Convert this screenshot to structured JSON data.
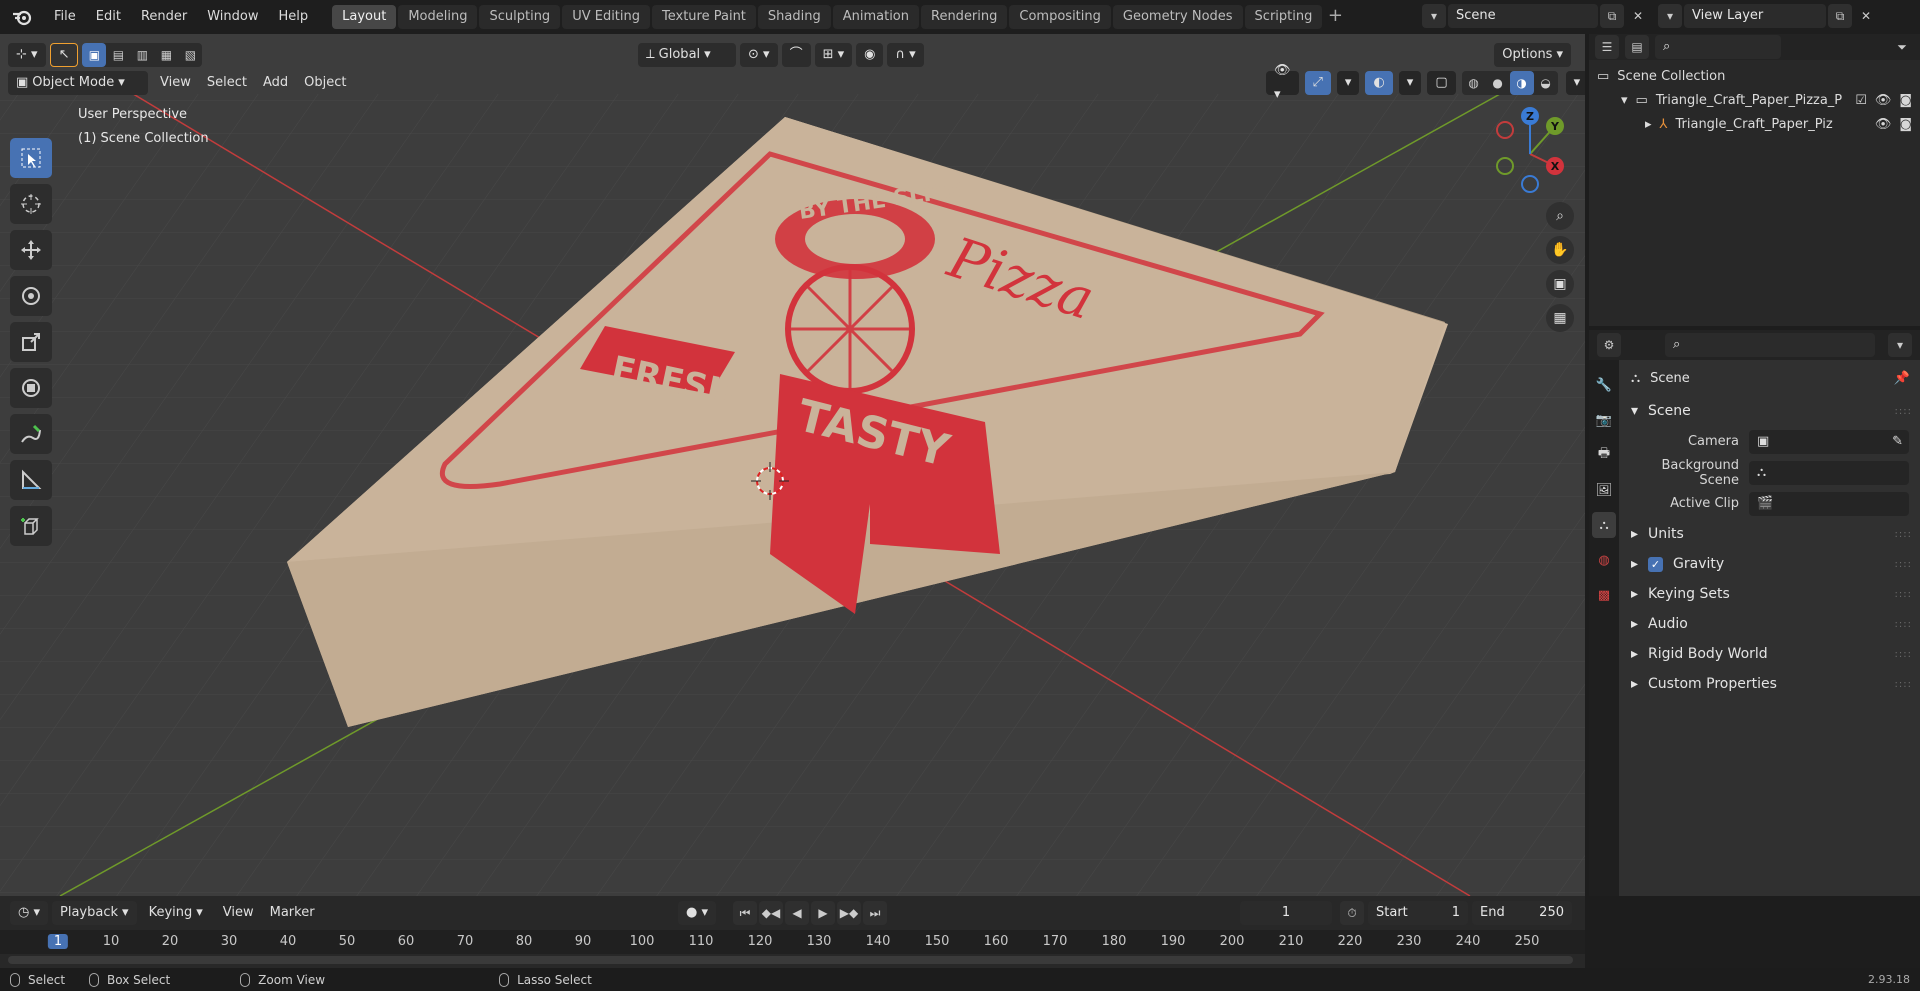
{
  "topbar": {
    "menus": [
      "File",
      "Edit",
      "Render",
      "Window",
      "Help"
    ],
    "workspaces": [
      "Layout",
      "Modeling",
      "Sculpting",
      "UV Editing",
      "Texture Paint",
      "Shading",
      "Animation",
      "Rendering",
      "Compositing",
      "Geometry Nodes",
      "Scripting"
    ],
    "active_workspace": "Layout",
    "scene_name": "Scene",
    "view_layer": "View Layer"
  },
  "viewport": {
    "mode": "Object Mode",
    "menus": [
      "View",
      "Select",
      "Add",
      "Object"
    ],
    "transform_orientation": "Global",
    "options_label": "Options",
    "overlay_line1": "User Perspective",
    "overlay_line2": "(1) Scene Collection",
    "object_text": {
      "by_the_slice": "BY THE SLICE",
      "pizza": "Pizza",
      "fresh": "FRESH",
      "tasty": "TASTY"
    },
    "colors": {
      "box": "#c9b39a",
      "print": "#d2333c",
      "x_axis": "#c23c3c",
      "y_axis": "#6f9a2a",
      "bg": "#3d3d3d"
    }
  },
  "gizmo": {
    "x": "X",
    "y": "Y",
    "z": "Z"
  },
  "outliner": {
    "root": "Scene Collection",
    "items": [
      {
        "label": "Triangle_Craft_Paper_Pizza_P",
        "type": "collection"
      },
      {
        "label": "Triangle_Craft_Paper_Piz",
        "type": "object"
      }
    ]
  },
  "properties": {
    "title": "Scene",
    "panel": "Scene",
    "fields": [
      {
        "label": "Camera",
        "value": ""
      },
      {
        "label": "Background Scene",
        "value": ""
      },
      {
        "label": "Active Clip",
        "value": ""
      }
    ],
    "sections": [
      "Units",
      "Gravity",
      "Keying Sets",
      "Audio",
      "Rigid Body World",
      "Custom Properties"
    ],
    "gravity_checked": true
  },
  "timeline": {
    "menus": [
      "Playback",
      "Keying",
      "View",
      "Marker"
    ],
    "current_frame": "1",
    "start_label": "Start",
    "start": "1",
    "end_label": "End",
    "end": "250",
    "ticks": [
      "1",
      "10",
      "20",
      "30",
      "40",
      "50",
      "60",
      "70",
      "80",
      "90",
      "100",
      "110",
      "120",
      "130",
      "140",
      "150",
      "160",
      "170",
      "180",
      "190",
      "200",
      "210",
      "220",
      "230",
      "240",
      "250"
    ]
  },
  "statusbar": {
    "select": "Select",
    "box_select": "Box Select",
    "zoom_view": "Zoom View",
    "lasso_select": "Lasso Select",
    "version": "2.93.18"
  }
}
